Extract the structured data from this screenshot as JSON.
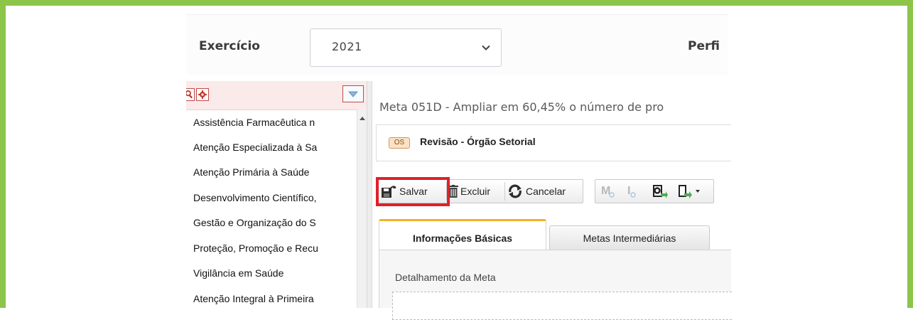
{
  "header": {
    "exercicio_label": "Exercício",
    "year_value": "2021",
    "perfil_label": "Perfi"
  },
  "left_panel": {
    "items": [
      "Assistência Farmacêutica n",
      "Atenção Especializada à Sa",
      "Atenção Primária à Saúde",
      "Desenvolvimento Científico,",
      "Gestão e Organização do S",
      "Proteção, Promoção e Recu",
      "Vigilância em Saúde",
      "Atenção Integral à Primeira"
    ]
  },
  "main": {
    "meta_title": "Meta 051D - Ampliar em 60,45% o número de pro",
    "status_badge": "OS",
    "status_text": "Revisão - Órgão Setorial",
    "toolbar": {
      "save": "Salvar",
      "delete": "Excluir",
      "cancel": "Cancelar",
      "m_btn": "M",
      "i_btn": "I"
    },
    "tabs": [
      {
        "label": "Informações Básicas"
      },
      {
        "label": "Metas Intermediárias"
      }
    ],
    "section_label": "Detalhamento da Meta"
  },
  "colors": {
    "frame_border": "#8dc44a",
    "highlight": "#e0202a",
    "active_tab_accent": "#f1b12a"
  }
}
